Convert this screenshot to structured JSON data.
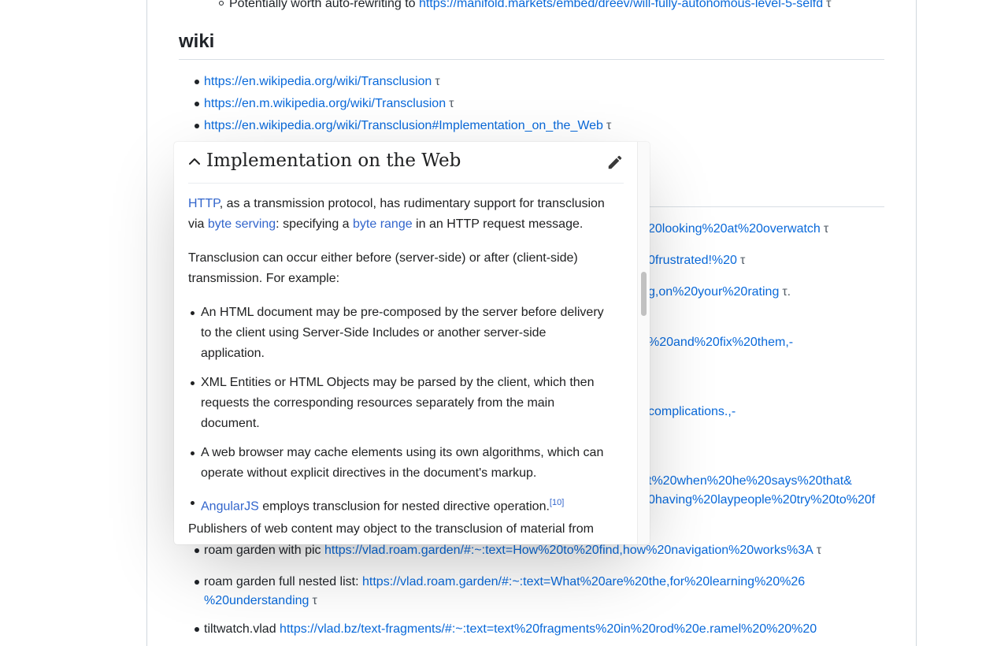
{
  "top_item": {
    "text": "Potentially worth auto-rewriting to ",
    "link": "https://manifold.markets/embed/dreev/will-fully-autonomous-level-5-selfd",
    "marker": "τ"
  },
  "wiki": {
    "heading": "wiki",
    "links": [
      {
        "url": "https://en.wikipedia.org/wiki/Transclusion",
        "marker": "τ"
      },
      {
        "url": "https://en.m.wikipedia.org/wiki/Transclusion",
        "marker": "τ"
      },
      {
        "url": "https://en.wikipedia.org/wiki/Transclusion#Implementation_on_the_Web",
        "marker": "τ"
      }
    ]
  },
  "background_fragments": [
    {
      "text": "20looking%20at%20overwatch",
      "marker": "τ"
    },
    {
      "text": "0frustrated!%20",
      "marker": "τ"
    },
    {
      "text": "g,on%20your%20rating",
      "marker": "τ."
    },
    {
      "text": "%20and%20fix%20them,-",
      "marker": ""
    },
    {
      "text": "complications.,-",
      "marker": ""
    },
    {
      "text": "t%20when%20he%20says%20that&",
      "marker": ""
    },
    {
      "text": "0having%20laypeople%20try%20to%20f",
      "marker": ""
    }
  ],
  "bottom_items": [
    {
      "text": "roam garden with pic ",
      "link": "https://vlad.roam.garden/#:~:text=How%20to%20find,how%20navigation%20works%3A",
      "marker": "τ"
    },
    {
      "text": "roam garden full nested list: ",
      "link": "https://vlad.roam.garden/#:~:text=What%20are%20the,for%20learning%20%26",
      "link2": "%20understanding",
      "marker": "τ"
    },
    {
      "text": "tiltwatch.vlad ",
      "link": "https://vlad.bz/text-fragments/#:~:text=text%20fragments%20in%20rod%20e.ramel%20%20%20"
    }
  ],
  "popup": {
    "title": "Implementation on the Web",
    "p1": {
      "link1": "HTTP",
      "t1": ", as a transmission protocol, has rudimentary support for transclusion",
      "t2": "via ",
      "link2": "byte serving",
      "t3": ": specifying a ",
      "link3": "byte range",
      "t4": " in an HTTP request message."
    },
    "p2_line1": "Transclusion can occur either before (server-side) or after (client-side)",
    "p2_line2": "transmission. For example:",
    "bullets": [
      {
        "lines": [
          "An HTML document may be pre-composed by the server before delivery",
          "to the client using Server-Side Includes or another server-side",
          "application."
        ]
      },
      {
        "lines": [
          "XML Entities or HTML Objects may be parsed by the client, which then",
          "requests the corresponding resources separately from the main",
          "document."
        ]
      },
      {
        "lines": [
          "A web browser may cache elements using its own algorithms, which can",
          "operate without explicit directives in the document's markup."
        ]
      }
    ],
    "last_bullet": {
      "link": "AngularJS",
      "text": " employs transclusion for nested directive operation.",
      "ref": "[10]"
    },
    "p3": "Publishers of web content may object to the transclusion of material from"
  }
}
